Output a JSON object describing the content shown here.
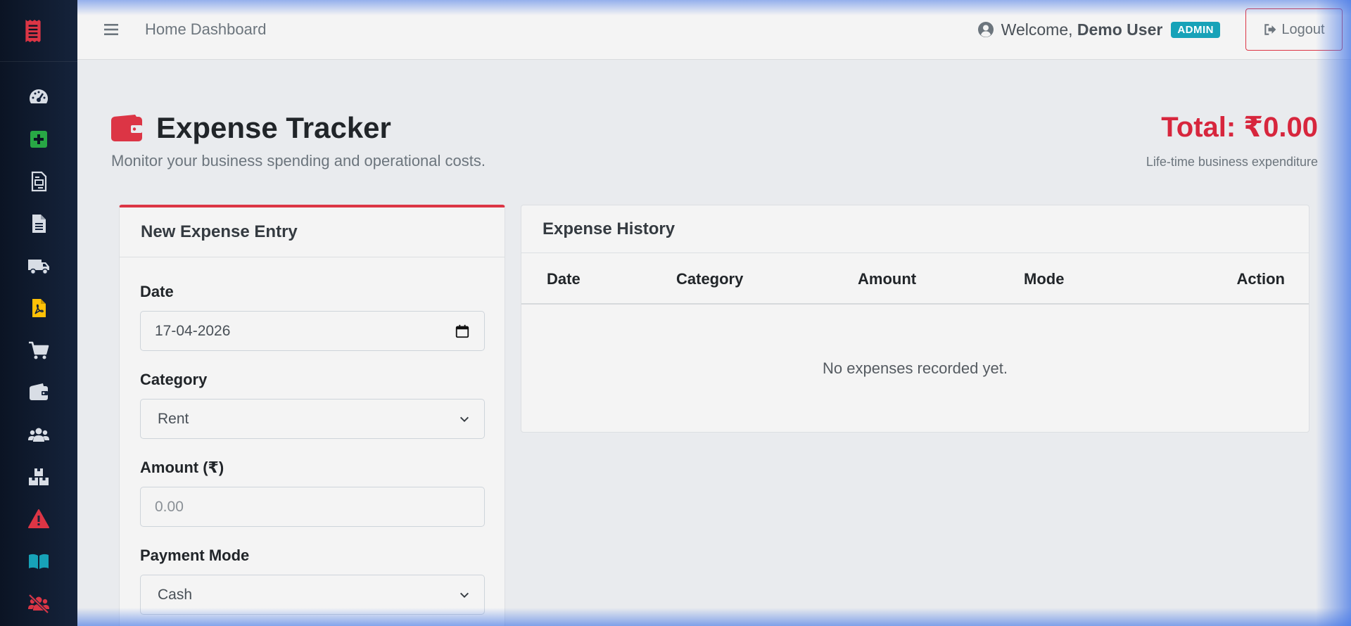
{
  "header": {
    "breadcrumb": "Home Dashboard",
    "welcome_prefix": "Welcome,",
    "user_name": "Demo User",
    "role_badge": "ADMIN",
    "logout_label": "Logout"
  },
  "sidebar": {
    "items": [
      {
        "icon": "tachometer-icon",
        "color": "#d8dde5"
      },
      {
        "icon": "plus-square-icon",
        "color": "#28a745"
      },
      {
        "icon": "invoice-icon",
        "color": "#d8dde5"
      },
      {
        "icon": "document-icon",
        "color": "#d8dde5"
      },
      {
        "icon": "truck-icon",
        "color": "#d8dde5"
      },
      {
        "icon": "pdf-file-icon",
        "color": "#ffc107"
      },
      {
        "icon": "cart-icon",
        "color": "#d8dde5"
      },
      {
        "icon": "wallet-icon",
        "color": "#d8dde5"
      },
      {
        "icon": "users-icon",
        "color": "#d8dde5"
      },
      {
        "icon": "boxes-icon",
        "color": "#d8dde5"
      },
      {
        "icon": "warning-icon",
        "color": "#dc3545"
      },
      {
        "icon": "book-icon",
        "color": "#17a2b8"
      },
      {
        "icon": "user-slash-icon",
        "color": "#dc3545"
      }
    ]
  },
  "page": {
    "title": "Expense Tracker",
    "subtitle": "Monitor your business spending and operational costs.",
    "total": "Total: ₹0.00",
    "total_caption": "Life-time business expenditure"
  },
  "form": {
    "title": "New Expense Entry",
    "date_label": "Date",
    "date_value": "17-04-2026",
    "category_label": "Category",
    "category_value": "Rent",
    "amount_label": "Amount (₹)",
    "amount_placeholder": "0.00",
    "payment_label": "Payment Mode",
    "payment_value": "Cash"
  },
  "history": {
    "title": "Expense History",
    "columns": [
      "Date",
      "Category",
      "Amount",
      "Mode",
      "Action"
    ],
    "empty_message": "No expenses recorded yet."
  },
  "colors": {
    "accent_red": "#dc3545",
    "total_red": "#d7263d",
    "badge_teal": "#17a2b8",
    "sidebar_bg": "#0b1424"
  }
}
